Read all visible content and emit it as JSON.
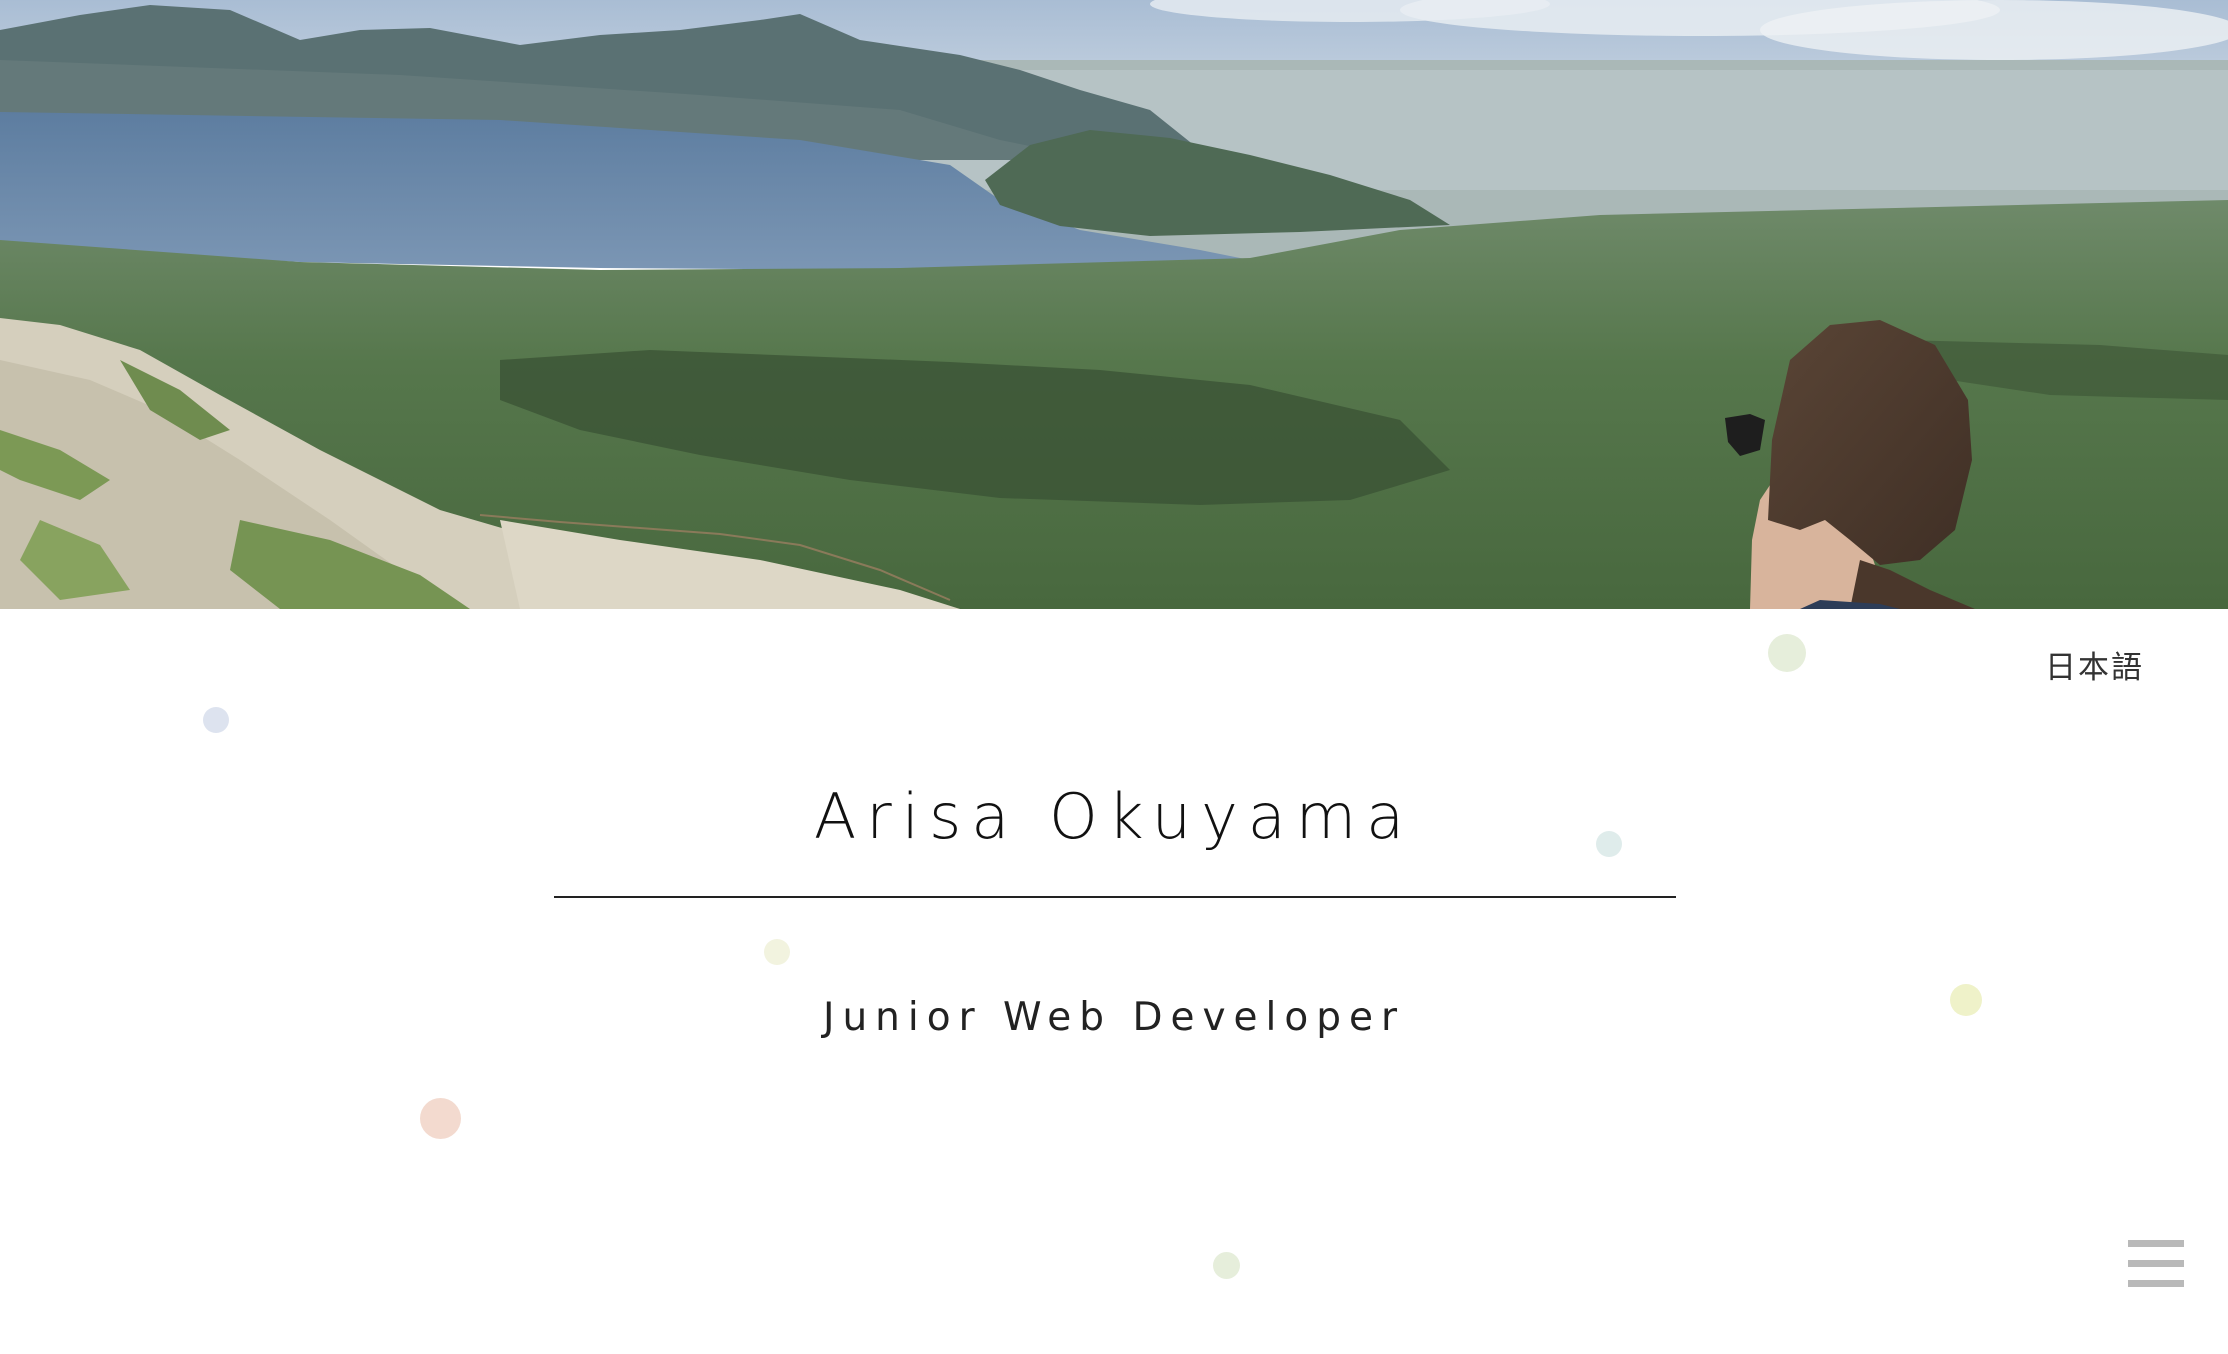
{
  "header": {
    "hero_image": "mountain-lake-landscape-photo",
    "language_link": "日本語"
  },
  "main": {
    "name": "Arisa Okuyama",
    "role": "Junior Web Developer"
  },
  "decor": {
    "dot_colors": [
      "#dde3ef",
      "#e6eedb",
      "#dfeceb",
      "#f2f3df",
      "#eff2c9",
      "#f3dacf",
      "#e6eedb"
    ]
  },
  "nav": {
    "menu_icon": "hamburger-menu-icon"
  },
  "colors": {
    "background": "#ffffff",
    "text": "#111111",
    "rule": "#222222",
    "menu_icon": "#b9b9b9"
  }
}
